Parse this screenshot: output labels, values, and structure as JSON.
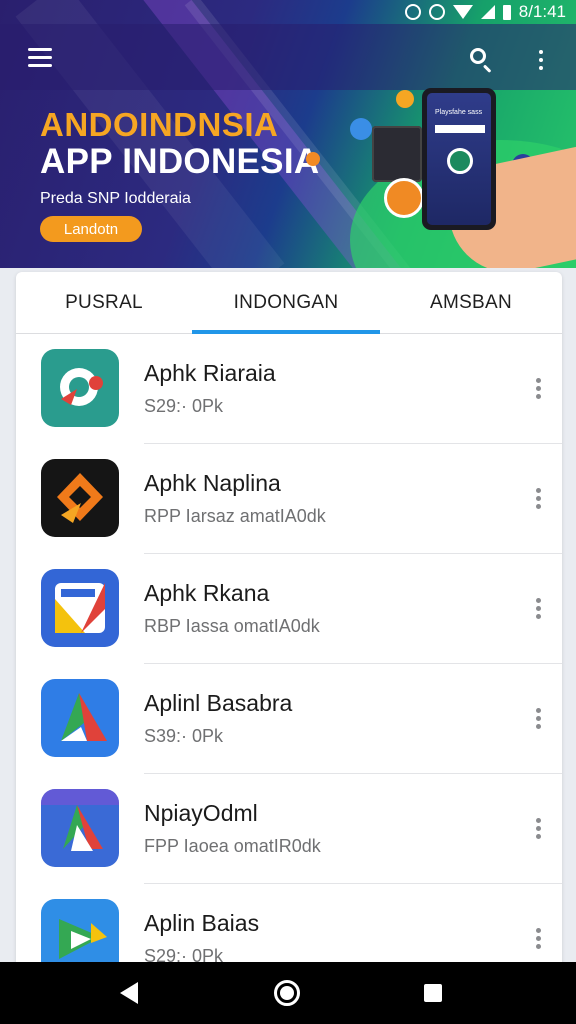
{
  "status_bar": {
    "time": "8/1:41"
  },
  "app_bar": {
    "menu_icon": "hamburger-menu-icon",
    "search_icon": "search-icon",
    "more_icon": "more-vert-icon"
  },
  "hero": {
    "title_line1": "ANDOINDNSIA",
    "title_line2": "APP INDONESIA",
    "subtitle": "Preda SNP Iodderaia",
    "button_label": "Landotn",
    "phone_screen_text": "Playsfahe sass",
    "accent_color": "#f39a1e"
  },
  "tabs": [
    {
      "label": "PUSRAL",
      "selected": false
    },
    {
      "label": "INDONGAN",
      "selected": true
    },
    {
      "label": "AMSBAN",
      "selected": false
    }
  ],
  "apps": [
    {
      "name": "Aphk Riaraia",
      "meta": "S29:· 0Pk",
      "icon": "cloud-app-icon"
    },
    {
      "name": "Aphk Naplina",
      "meta": "RPP Iarsaz amatIA0dk",
      "icon": "diamond-app-icon"
    },
    {
      "name": "Aphk Rkana",
      "meta": "RBP Iassa omatIA0dk",
      "icon": "folder-app-icon"
    },
    {
      "name": "Aplinl Basabra",
      "meta": "S39:· 0Pk",
      "icon": "triangle-app-icon"
    },
    {
      "name": "NpiayOdml",
      "meta": "FPP Iaoea omatIR0dk",
      "icon": "arrow-app-icon"
    },
    {
      "name": "Aplin Baias",
      "meta": "S29:· 0Pk",
      "icon": "play-app-icon"
    }
  ],
  "nav": {
    "back_icon": "back-icon",
    "home_icon": "home-icon",
    "recents_icon": "recents-icon"
  }
}
